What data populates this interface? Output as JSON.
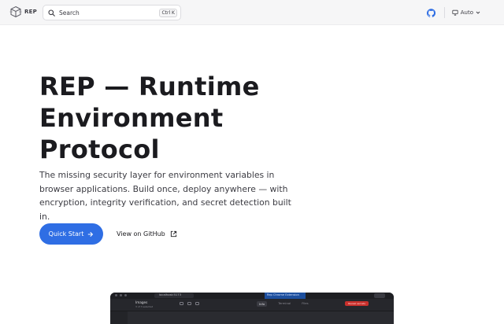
{
  "header": {
    "logo_text": "REP",
    "search": {
      "label": "Search",
      "shortcut": "Ctrl K"
    },
    "theme_label": "Auto"
  },
  "hero": {
    "title": "REP — Runtime Environment Protocol",
    "tagline": "The missing security layer for environment variables in browser applications. Build once, deploy anywhere — with encryption, integrity verification, and secret detection built in.",
    "primary_action": "Quick Start",
    "secondary_action": "View on GitHub"
  },
  "preview": {
    "url_text": "localhost:5173",
    "highlight_tab": "Rep Chrome Extension",
    "panel_title": "Images",
    "panel_subtitle": "3 of 3 selected",
    "tabs": [
      "Info",
      "Terminal",
      "Files"
    ],
    "alert_button": "Reveal secrets"
  },
  "colors": {
    "accent": "#2f6ee4",
    "header_bg": "#f6f6f7",
    "text_primary": "#1b1b1f",
    "text_secondary": "#3c3c43"
  },
  "icons": {
    "logo": "cube-logo-icon",
    "search": "search-icon",
    "github": "github-icon",
    "theme": "monitor-icon",
    "theme_caret": "chevron-down-icon",
    "quick_start_arrow": "arrow-right-icon",
    "github_link": "external-link-icon"
  }
}
